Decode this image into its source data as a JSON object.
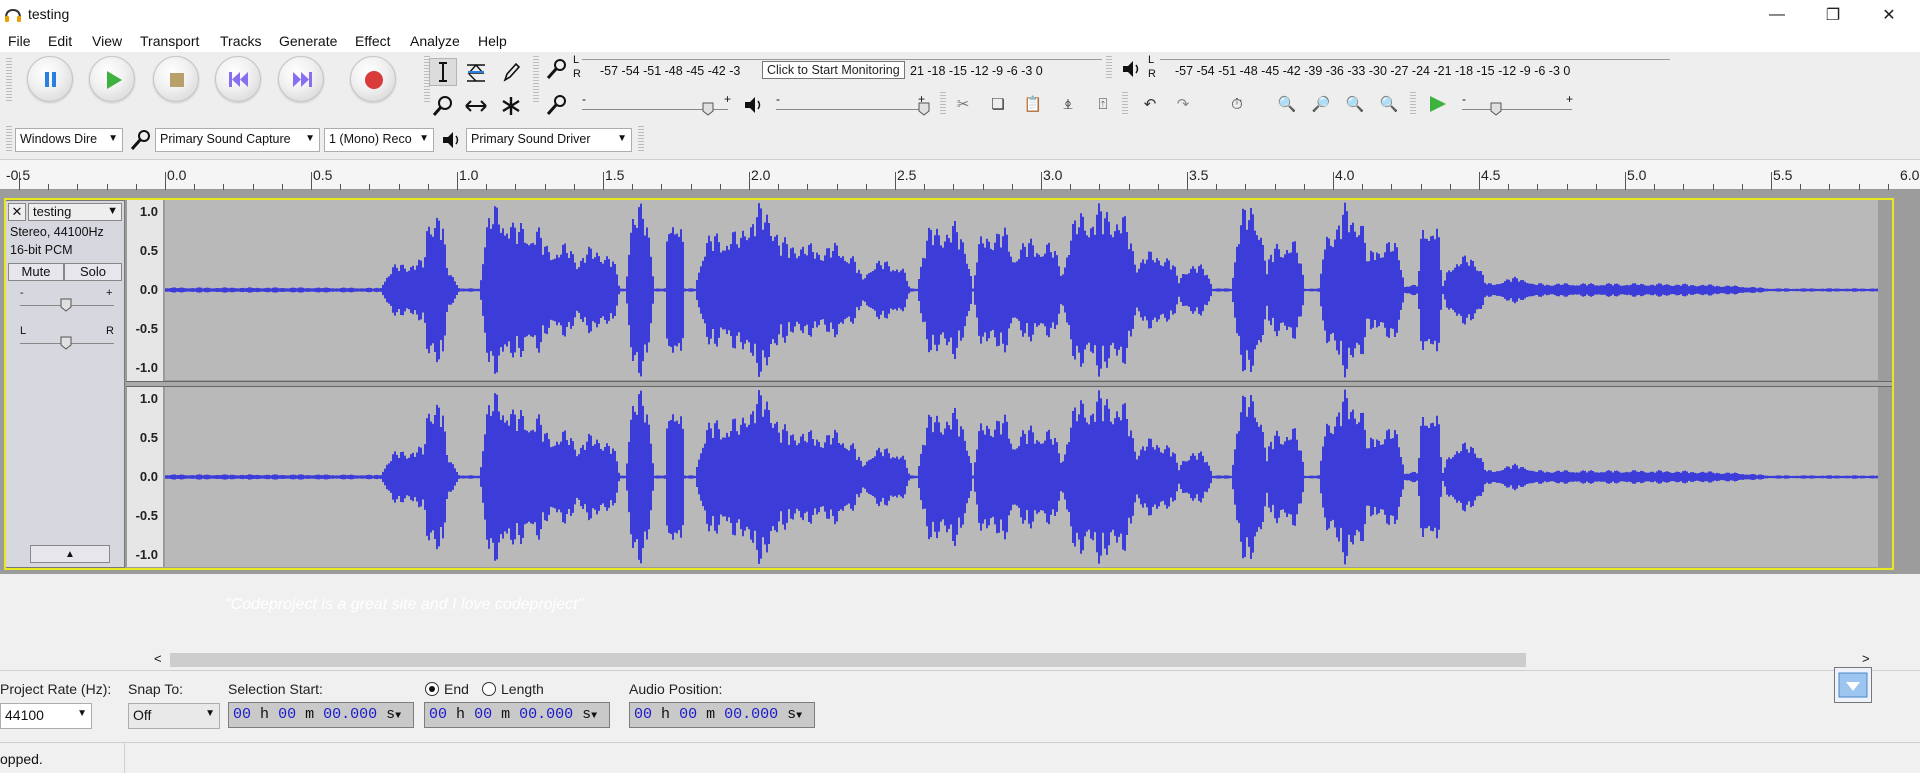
{
  "window": {
    "title": "testing"
  },
  "menu": [
    "File",
    "Edit",
    "View",
    "Transport",
    "Tracks",
    "Generate",
    "Effect",
    "Analyze",
    "Help"
  ],
  "meters": {
    "record_scale": "-57 -54 -51 -48 -45 -42 -3",
    "record_scale_tail": "21 -18 -15 -12 -9 -6 -3 0",
    "monitor_tooltip": "Click to Start Monitoring",
    "playback_scale": "-57 -54 -51 -48 -45 -42 -39 -36 -33 -30 -27 -24 -21 -18 -15 -12 -9 -6 -3 0",
    "lr_L": "L",
    "lr_R": "R"
  },
  "sliders": {
    "minus": "-",
    "plus": "+"
  },
  "devices": {
    "host": "Windows Dire",
    "recording_device": "Primary Sound Capture",
    "channels": "1 (Mono) Reco",
    "playback_device": "Primary Sound Driver"
  },
  "ruler": [
    "-0.5",
    "0.0",
    "0.5",
    "1.0",
    "1.5",
    "2.0",
    "2.5",
    "3.0",
    "3.5",
    "4.0",
    "4.5",
    "5.0",
    "5.5",
    "6.0"
  ],
  "track": {
    "name": "testing",
    "info_rate": "Stereo, 44100Hz",
    "info_format": "16-bit PCM",
    "mute": "Mute",
    "solo": "Solo",
    "gain_minus": "-",
    "gain_plus": "+",
    "pan_L": "L",
    "pan_R": "R",
    "scale": [
      "1.0",
      "0.5",
      "0.0",
      "-0.5",
      "-1.0"
    ]
  },
  "label_track": {
    "text": "\"Codeproject is a great site and I love codeproject\""
  },
  "selection_toolbar": {
    "project_rate_label": "Project Rate (Hz):",
    "project_rate_value": "44100",
    "snap_label": "Snap To:",
    "snap_value": "Off",
    "selection_start_label": "Selection Start:",
    "end_label": "End",
    "length_label": "Length",
    "audio_position_label": "Audio Position:",
    "time_value": {
      "h": "00",
      "m": "00",
      "s": "00.000",
      "h_unit": "h",
      "m_unit": "m",
      "s_unit": "s"
    }
  },
  "status": {
    "text": "opped."
  },
  "colors": {
    "waveform": "#3c3cd8",
    "track_bg": "#b9b9b9",
    "selection_border": "#e8e820"
  }
}
